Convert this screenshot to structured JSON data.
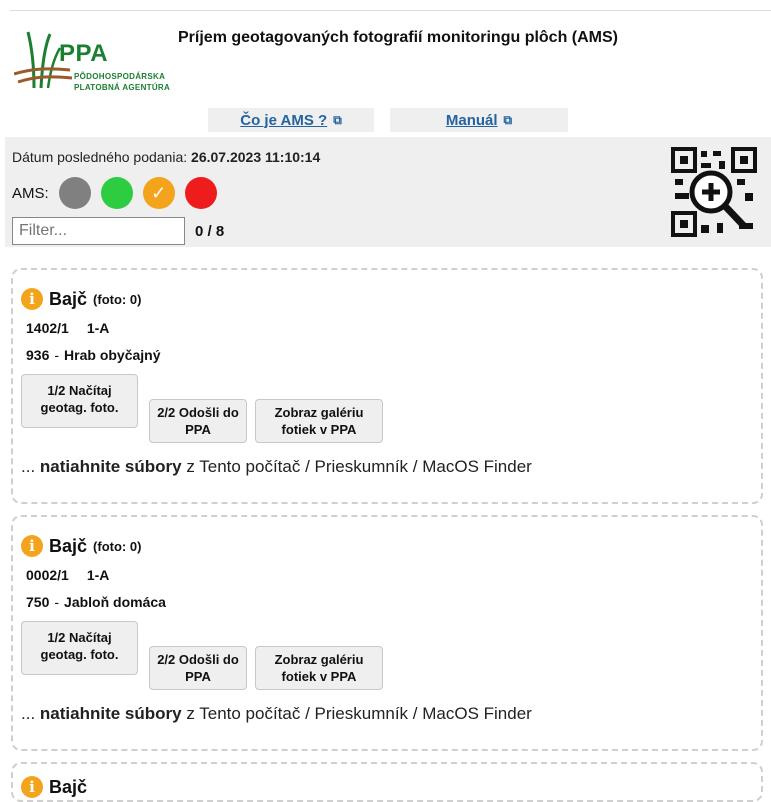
{
  "header": {
    "title": "Príjem geotagovaných fotografií monitoringu plôch (AMS)",
    "logo": {
      "brand": "PPA",
      "line1": "PÔDOHOSPODÁRSKA",
      "line2": "PLATOBNÁ AGENTÚRA"
    },
    "links": [
      {
        "label": "Čo je AMS ?",
        "icon": "external-link-icon"
      },
      {
        "label": "Manuál",
        "icon": "external-link-icon"
      }
    ]
  },
  "status": {
    "last_label": "Dátum posledného podania:",
    "last_value": "26.07.2023 11:10:14",
    "ams_label": "AMS:",
    "filter_placeholder": "Filter...",
    "count": "0 / 8",
    "colors": {
      "gray": "#808080",
      "green": "#2ecc40",
      "orange": "#f4a41c",
      "red": "#ee1c1c"
    }
  },
  "cards": [
    {
      "name": "Bajč",
      "foto": "(foto: 0)",
      "parcel": "1402/1",
      "code": "1-A",
      "num": "936",
      "sep": "-",
      "species": "Hrab obyčajný",
      "btn_load": "1/2 Načítaj geotag. foto.",
      "btn_send": "2/2 Odošli do PPA",
      "btn_gallery": "Zobraz galériu fotiek v PPA",
      "drag_prefix": "...",
      "drag_bold": "natiahnite súbory",
      "drag_rest": "z Tento počítač / Prieskumník / MacOS Finder"
    },
    {
      "name": "Bajč",
      "foto": "(foto: 0)",
      "parcel": "0002/1",
      "code": "1-A",
      "num": "750",
      "sep": "-",
      "species": "Jabloň domáca",
      "btn_load": "1/2 Načítaj geotag. foto.",
      "btn_send": "2/2 Odošli do PPA",
      "btn_gallery": "Zobraz galériu fotiek v PPA",
      "drag_prefix": "...",
      "drag_bold": "natiahnite súbory",
      "drag_rest": "z Tento počítač / Prieskumník / MacOS Finder"
    },
    {
      "name": "Bajč"
    }
  ]
}
